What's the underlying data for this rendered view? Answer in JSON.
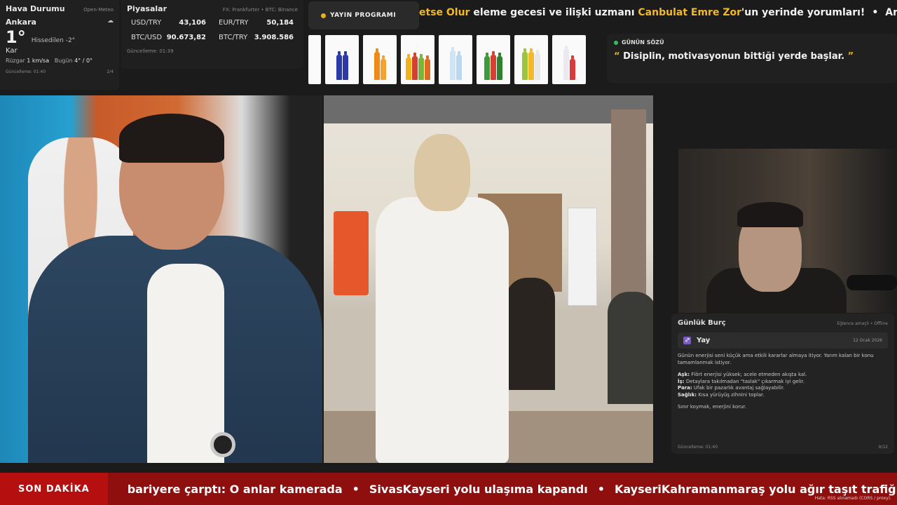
{
  "weather": {
    "title": "Hava Durumu",
    "source": "Open-Meteo",
    "city": "Ankara",
    "icon": "cloud-icon",
    "temperature": "1°",
    "feels_like": "Hissedilen -2°",
    "condition": "Kar",
    "wind_label": "Rüzgar",
    "wind_value": "1 km/sa",
    "today_label": "Bugün",
    "today_value": "4° / 0°",
    "updated": "Güncelleme: 01:40",
    "page": "2/4"
  },
  "market": {
    "title": "Piyasalar",
    "source": "FX: Frankfurter • BTC: Binance",
    "rates": [
      {
        "pair": "USD/TRY",
        "value": "43,106"
      },
      {
        "pair": "EUR/TRY",
        "value": "50,184"
      },
      {
        "pair": "BTC/USD",
        "value": "90.673,82"
      },
      {
        "pair": "BTC/TRY",
        "value": "3.908.586"
      }
    ],
    "updated": "Güncelleme: 01:39"
  },
  "program": {
    "label": "YAYIN PROGRAMI"
  },
  "top_ticker": {
    "part1": "etse Olur",
    "part2": " eleme gecesi ve ilişki uzmanı ",
    "part3": "Canbulat Emre Zor",
    "part4": "'un yerinde yorumları!",
    "sep": "•",
    "part5": "Ard"
  },
  "quote": {
    "label": "GÜNÜN SÖZÜ",
    "text": "Disiplin, motivasyonun bittiği yerde başlar."
  },
  "horoscope": {
    "title": "Günlük Burç",
    "note": "Eğlence amaçlı • Offline",
    "sign": "Yay",
    "date": "12 Ocak 2026",
    "intro": "Günün enerjisi seni küçük ama etkili kararlar almaya itiyor. Yarım kalan bir konu tamamlanmak istiyor.",
    "ask_label": "Aşk:",
    "ask": "Flört enerjisi yüksek; acele etmeden akışta kal.",
    "is_label": "İş:",
    "is": "Detaylara takılmadan \"taslak\" çıkarmak iyi gelir.",
    "para_label": "Para:",
    "para": "Ufak bir pazarlık avantaj sağlayabilir.",
    "saglik_label": "Sağlık:",
    "saglik": "Kısa yürüyüş zihnini toplar.",
    "closing": "Sınır koymak, enerjini korur.",
    "updated": "Güncelleme: 01:40",
    "page": "9/12"
  },
  "breaking": {
    "label": "SON DAKİKA",
    "items": [
      "bariyere çarptı: O anlar kamerada",
      "SivasKayseri yolu ulaşıma kapandı",
      "KayseriKahramanmaraş yolu ağır taşıt trafiğine kapat"
    ],
    "sep": "•",
    "error": "Hata: RSS alınamadı (CORS / proxy)."
  },
  "colors": {
    "accent": "#f2b829",
    "breaking_bg": "#8f0f0f",
    "breaking_label": "#b50f0f",
    "quote_dot": "#31c05f"
  }
}
